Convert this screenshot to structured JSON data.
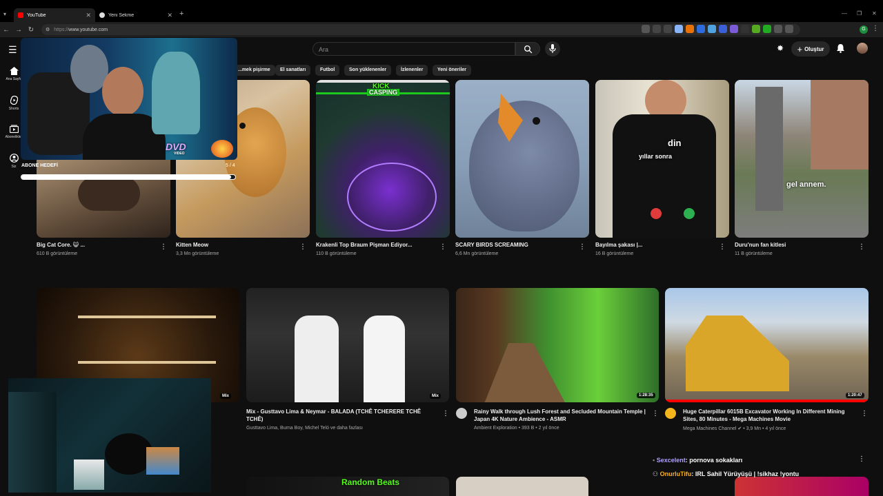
{
  "browser": {
    "tabs": [
      {
        "title": "YouTube",
        "active": true
      },
      {
        "title": "Yeni Sekme",
        "active": false
      }
    ],
    "url_proto": "https://",
    "url_host": "www.youtube.com"
  },
  "header": {
    "search_placeholder": "Ara",
    "create_label": "Oluştur"
  },
  "sidebar": {
    "items": [
      {
        "label": "Ana Sayfa"
      },
      {
        "label": "Shorts"
      },
      {
        "label": "Abonelikler"
      },
      {
        "label": "Siz"
      }
    ]
  },
  "chips": [
    "...mek pişirme",
    "El sanatları",
    "Futbol",
    "Son yüklenenler",
    "İzlenenler",
    "Yeni öneriler"
  ],
  "row1": [
    {
      "title": "Big Cat Core. 😺 ...",
      "meta": "610 B görüntüleme"
    },
    {
      "title": "Kitten Meow",
      "meta": "3,3 Mn görüntüleme"
    },
    {
      "title": "Krakenli Top Braum Pişman Ediyor...",
      "meta": "110 B görüntüleme"
    },
    {
      "title": "SCARY BIRDS SCREAMING",
      "meta": "6,6 Mn görüntüleme"
    },
    {
      "title": "Bayılma şakası |...",
      "meta": "16 B görüntüleme"
    },
    {
      "title": "Duru'nun fan kitlesi",
      "meta": "11 B görüntüleme"
    }
  ],
  "thumb_texts": {
    "kick": "KICK",
    "casping": "CASPING",
    "dvd": "DVD",
    "dvd_sub": "VIDEO",
    "tshirt_1": "yıllar sonra",
    "tshirt_2": "din",
    "gel_annem": "gel annem.",
    "random_beats": "Random Beats"
  },
  "row2": [
    {
      "title": "",
      "meta": "",
      "badge": "Mix"
    },
    {
      "title": "Mix - Gusttavo Lima & Neymar - BALADA (TCHÊ TCHERERE TCHÊ TCHÊ)",
      "meta": "Gusttavo Lima, Burna Boy, Michel Teló ve daha fazlası",
      "badge": "Mix"
    },
    {
      "title": "Rainy Walk through Lush Forest and Secluded Mountain Temple | Japan 4K Nature Ambience - ASMR",
      "channel": "Ambient Exploration",
      "meta": "• 393 B • 2 yıl önce",
      "badge": "1:28:35"
    },
    {
      "title": "Huge Caterpillar 6015B Excavator Working In Different Mining Sites, 80 Minutes - Mega Machines Movie",
      "channel": "Mega Machines Channel ✔",
      "meta": "• 3,9 Mn • 4 yıl önce",
      "badge": "1:20:47"
    }
  ],
  "stream": {
    "sub_goal_label": "ABONE HEDEFİ",
    "sub_goal_count": "5 / 4",
    "sub_goal_progress": 0.98
  },
  "chat": [
    {
      "user": "Sexcelent",
      "message": ": pornova sokakları",
      "color": "#b0a0ff"
    },
    {
      "user": "OnurluTifu",
      "message": ": IRL Sahil Yürüyüşü | !sikhaz !yontu",
      "color": "#ffb020"
    }
  ],
  "colors": {
    "bg": "#0f0f0f",
    "chip": "#272727",
    "accent_red": "#ff0000"
  }
}
